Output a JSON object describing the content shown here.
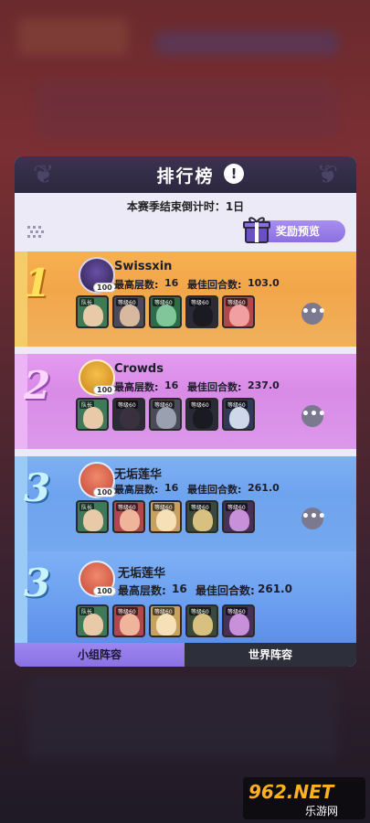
{
  "panel": {
    "title": "排行榜",
    "info_icon": "!",
    "countdown": "本赛季结束倒计时：1日",
    "reward_button": "奖励预览"
  },
  "entries": [
    {
      "rank": "1",
      "name": "Swissxin",
      "level": "100",
      "max_floor_label": "最高层数:",
      "max_floor": "16",
      "best_round_label": "最佳回合数:",
      "best_round": "103.0"
    },
    {
      "rank": "2",
      "name": "Crowds",
      "level": "100",
      "max_floor_label": "最高层数:",
      "max_floor": "16",
      "best_round_label": "最佳回合数:",
      "best_round": "237.0"
    },
    {
      "rank": "3",
      "name": "无垢莲华",
      "level": "100",
      "max_floor_label": "最高层数:",
      "max_floor": "16",
      "best_round_label": "最佳回合数:",
      "best_round": "261.0"
    },
    {
      "rank": "3",
      "name": "无垢莲华",
      "level": "100",
      "max_floor_label": "最高层数:",
      "max_floor": "16",
      "best_round_label": "最佳回合数:",
      "best_round": "261.0"
    }
  ],
  "hero_tag": "等级60",
  "leader_tag": "队长",
  "more_icon": "•••",
  "tabs": {
    "team": "小组阵容",
    "world": "世界阵容"
  },
  "watermark": {
    "brand": "962.NET",
    "sub": "乐游网"
  },
  "colors": {
    "rank1": "#f2a64a",
    "rank2": "#d88be6",
    "rank3": "#6ea4ee",
    "accent": "#8b6fe0"
  }
}
